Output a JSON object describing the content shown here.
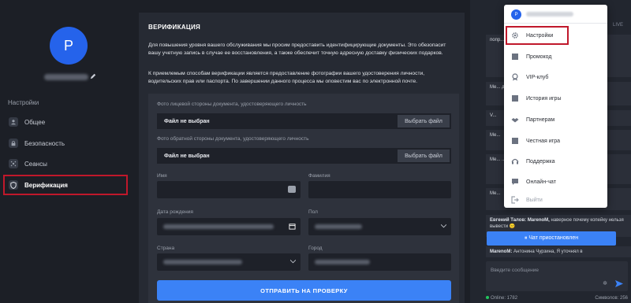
{
  "profile": {
    "avatar_letter": "P"
  },
  "sidebar": {
    "section_title": "Настройки",
    "items": [
      {
        "label": "Общее",
        "icon": "user-icon"
      },
      {
        "label": "Безопасность",
        "icon": "lock-icon"
      },
      {
        "label": "Сеансы",
        "icon": "sessions-icon"
      },
      {
        "label": "Верификация",
        "icon": "shield-icon",
        "active": true
      }
    ]
  },
  "main": {
    "title": "ВЕРИФИКАЦИЯ",
    "paragraph1": "Для повышения уровня вашего обслуживания мы просим предоставить идентифицирующие документы. Это обезопасит вашу учетную запись в случае ее восстановления, а также обеспечит точную адресную доставку физических подарков.",
    "paragraph2": "К приемлемым способам верификации является предоставление фотографии вашего удостоверения личности, водительских прав или паспорта. По завершении данного процесса мы оповестим вас по электронной почте."
  },
  "form": {
    "front_label": "Фото лицевой стороны документа, удостоверяющего личность",
    "back_label": "Фото обратной стороны документа, удостоверяющего личность",
    "no_file": "Файл не выбран",
    "choose_file": "Выбрать файл",
    "first_name_label": "Имя",
    "last_name_label": "Фамилия",
    "birth_date_label": "Дата рождения",
    "gender_label": "Пол",
    "country_label": "Страна",
    "city_label": "Город",
    "submit": "ОТПРАВИТЬ НА ПРОВЕРКУ"
  },
  "chat": {
    "live": "LIVE",
    "messages": [
      {
        "text": "попр... ало в чате..."
      },
      {
        "text": "Мe... додать адми..."
      },
      {
        "text": "V..."
      },
      {
        "text": "Мe..."
      },
      {
        "text": "Мe... ...бесегда боты..."
      },
      {
        "text": "Мe..."
      }
    ],
    "message_author": "Евгений Талов:",
    "message_mention": "MarenoM,",
    "message_text": "наверное почему копейку нельзя вывести 😐",
    "message2_author": "MarenoM:",
    "message2_text": "Антонина Чурзина, Я уточнял в",
    "paused": "⏸ Чат приостановлен",
    "input_placeholder": "Введите сообщение",
    "online": "Online: 1782",
    "symbols": "Символов: 256"
  },
  "dropdown": {
    "avatar_letter": "P",
    "items": [
      {
        "label": "Настройки",
        "icon": "gear-icon"
      },
      {
        "label": "Промокод",
        "icon": "promo-icon"
      },
      {
        "label": "VIP-клуб",
        "icon": "vip-icon"
      },
      {
        "label": "История игры",
        "icon": "history-icon"
      },
      {
        "label": "Партнерам",
        "icon": "partners-icon"
      },
      {
        "label": "Честная игра",
        "icon": "fair-play-icon"
      },
      {
        "label": "Поддержка",
        "icon": "support-icon"
      },
      {
        "label": "Онлайн-чат",
        "icon": "chat-icon"
      },
      {
        "label": "Выйти",
        "icon": "logout-icon"
      }
    ]
  }
}
